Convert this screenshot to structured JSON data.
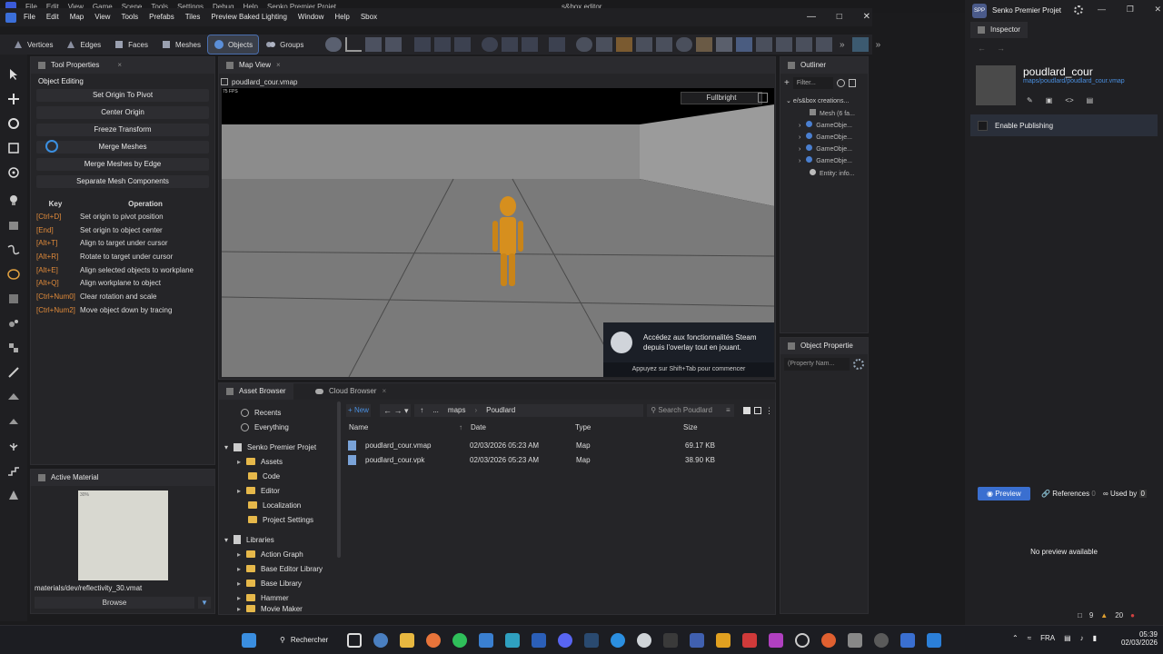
{
  "behind": {
    "menu": [
      "File",
      "Edit",
      "View",
      "Game",
      "Scene",
      "Tools",
      "Settings",
      "Debug",
      "Help",
      "Senko Premier Projet"
    ],
    "title": "s&box editor"
  },
  "menubar": {
    "items": [
      "File",
      "Edit",
      "Map",
      "View",
      "Tools",
      "Prefabs",
      "Tiles",
      "Preview Baked Lighting",
      "Window",
      "Help",
      "Sbox"
    ]
  },
  "toolbar": {
    "modes": [
      "Vertices",
      "Edges",
      "Faces",
      "Meshes",
      "Objects",
      "Groups"
    ]
  },
  "tool_properties": {
    "tab": "Tool Properties",
    "section": "Object Editing",
    "buttons": [
      "Set Origin To Pivot",
      "Center Origin",
      "Freeze Transform",
      "Merge Meshes",
      "Merge Meshes by Edge",
      "Separate Mesh Components"
    ],
    "headers": {
      "key": "Key",
      "operation": "Operation"
    },
    "shortcuts": [
      {
        "key": "[Ctrl+D]",
        "op": "Set origin to pivot position"
      },
      {
        "key": "[End]",
        "op": "Set origin to object center"
      },
      {
        "key": "[Alt+T]",
        "op": "Align to target under cursor"
      },
      {
        "key": "[Alt+R]",
        "op": "Rotate to target under cursor"
      },
      {
        "key": "[Alt+E]",
        "op": "Align selected objects to workplane"
      },
      {
        "key": "[Alt+Q]",
        "op": "Align workplane to object"
      },
      {
        "key": "[Ctrl+Num0]",
        "op": "Clear rotation and scale"
      },
      {
        "key": "[Ctrl+Num2]",
        "op": "Move object down by tracing"
      }
    ]
  },
  "active_material": {
    "tab": "Active Material",
    "path": "materials/dev/reflectivity_30.vmat",
    "browse": "Browse",
    "thumb_label": "30%"
  },
  "map_view": {
    "tab": "Map View",
    "file": "poudlard_cour.vmap",
    "fps": "75 FPS",
    "render_mode": "Fullbright"
  },
  "steam": {
    "line1": "Accédez aux fonctionnalités Steam",
    "line2": "depuis l'overlay tout en jouant.",
    "hint": "Appuyez sur Shift+Tab pour commencer"
  },
  "outliner": {
    "tab": "Outliner",
    "filter": "Filter...",
    "root": "e/s&box creations...",
    "items": [
      "Mesh (6 fa...",
      "GameObje...",
      "GameObje...",
      "GameObje...",
      "GameObje...",
      "Entity: info..."
    ]
  },
  "object_properties": {
    "tab": "Object Propertie",
    "placeholder": "(Property Nam..."
  },
  "asset_browser": {
    "tabs": [
      "Asset Browser",
      "Cloud Browser"
    ],
    "new": "New",
    "breadcrumb": [
      "...",
      "maps",
      "Poudlard"
    ],
    "search": "Search Poudlard",
    "tree": {
      "recents": "Recents",
      "everything": "Everything",
      "project": "Senko Premier Projet",
      "project_folders": [
        "Assets",
        "Code",
        "Editor",
        "Localization",
        "Project Settings"
      ],
      "libraries": "Libraries",
      "library_items": [
        "Action Graph",
        "Base Editor Library",
        "Base Library",
        "Hammer",
        "Movie Maker"
      ]
    },
    "columns": [
      "Name",
      "Date",
      "Type",
      "Size"
    ],
    "files": [
      {
        "name": "poudlard_cour.vmap",
        "date": "02/03/2026 05:23 AM",
        "type": "Map",
        "size": "69.17 KB"
      },
      {
        "name": "poudlard_cour.vpk",
        "date": "02/03/2026 05:23 AM",
        "type": "Map",
        "size": "38.90 KB"
      }
    ]
  },
  "inspector": {
    "app_badge": "SPP",
    "app_title": "Senko Premier Projet",
    "tab": "Inspector",
    "asset_name": "poudlard_cour",
    "asset_path": "maps/poudlard/poudlard_cour.vmap",
    "publishing": "Enable Publishing",
    "preview_tab": "Preview",
    "references": "References",
    "used_by": "Used by",
    "used_by_count": "0",
    "references_count": "0",
    "no_preview": "No preview available",
    "status_count1": "9",
    "status_count2": "20"
  },
  "taskbar": {
    "search": "Rechercher",
    "lang": "FRA",
    "time": "05:39",
    "date": "02/03/2026"
  }
}
